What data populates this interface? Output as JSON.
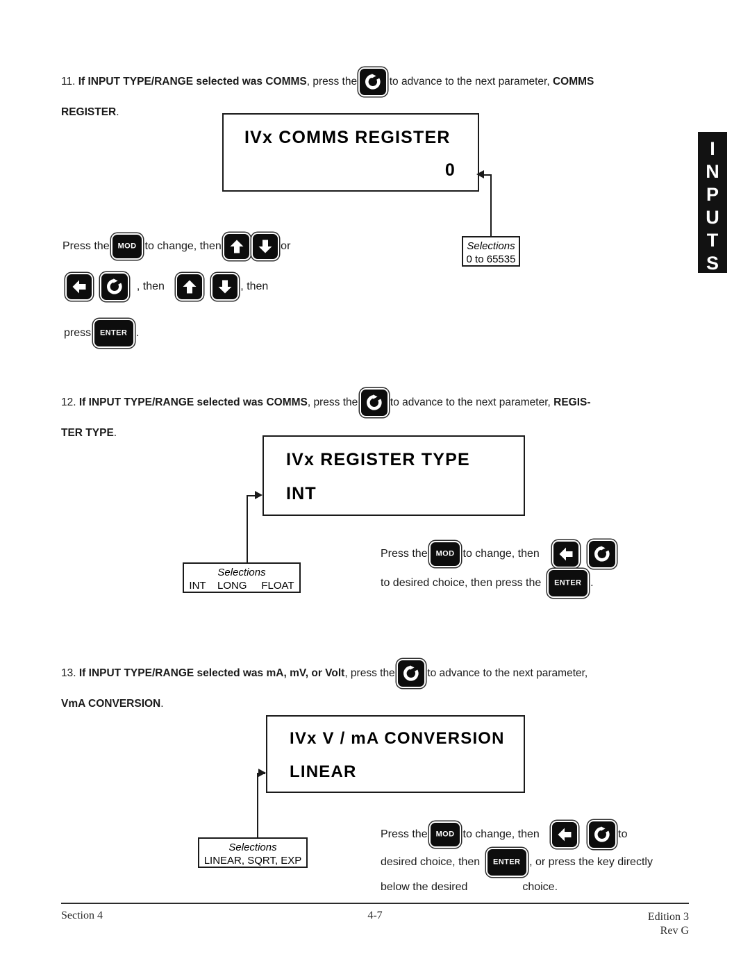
{
  "page": {
    "side_tab_label": "INPUTS",
    "side_tab_letters": [
      "I",
      "N",
      "P",
      "U",
      "T",
      "S"
    ]
  },
  "steps": [
    {
      "number": "11.",
      "text_before_key": "If INPUT TYPE/RANGE selected was COMMS",
      "lead_bold": "If INPUT TYPE/RANGE selected was COMMS",
      "after_bold": ", press the",
      "after_key": "to advance to the next parameter,",
      "param_bold": "COMMS",
      "continuation": "REGISTER",
      "continuation_period": ".",
      "key_icon": "advance-icon"
    },
    {
      "number": "12.",
      "lead_bold": "If INPUT TYPE/RANGE selected was COMMS",
      "after_bold": ", press the",
      "after_key": "to advance to the next parameter,",
      "param_bold": "REGIS-",
      "continuation": "TER TYPE",
      "continuation_period": ".",
      "key_icon": "advance-icon"
    },
    {
      "number": "13.",
      "lead_bold": "If INPUT TYPE/RANGE selected was mA, mV, or Volt",
      "after_bold": ", press the",
      "after_key": "to advance to the next parameter,",
      "param_bold": "",
      "continuation": "VmA CONVERSION",
      "continuation_period": ".",
      "key_icon": "advance-icon"
    }
  ],
  "displays": [
    {
      "line1": "IVx  COMMS  REGISTER",
      "line2": "0",
      "align2": "right"
    },
    {
      "line1": "IVx  REGISTER  TYPE",
      "line2": "INT",
      "align2": "left"
    },
    {
      "line1": "IVx  V / mA  CONVERSION",
      "line2": "LINEAR",
      "align2": "left"
    }
  ],
  "selections": [
    {
      "caption": "Selections",
      "values": "0 to 65535"
    },
    {
      "caption": "Selections",
      "values": "INT    LONG     FLOAT"
    },
    {
      "caption": "Selections",
      "values": "LINEAR, SQRT, EXP"
    }
  ],
  "instructions": {
    "block11": {
      "l1_a": "Press the",
      "l1_b": "to change, then",
      "l1_c": "or",
      "l2_a": ", then",
      "l2_b": ", then",
      "l3_a": "press",
      "l3_b": "."
    },
    "block12": {
      "l1_a": "Press  the",
      "l1_b": "to change, then",
      "l2_a": "to desired choice, then press the",
      "l2_b": "."
    },
    "block13": {
      "l1_a": "Press the",
      "l1_b": "to  change,  then",
      "l1_c": "to",
      "l2_a": "desired choice, then",
      "l2_b": ", or press the key directly",
      "l3_a": "below  the  desired",
      "l3_b": "choice."
    }
  },
  "keys": {
    "mod_label": "MOD",
    "enter_label": "ENTER",
    "up_icon": "arrow-up-icon",
    "down_icon": "arrow-down-icon",
    "left_icon": "arrow-left-icon",
    "advance_icon": "advance-icon"
  },
  "footer": {
    "left": "Section 4",
    "center": "4-7",
    "right_line1": "Edition 3",
    "right_line2": "Rev  G"
  },
  "colors": {
    "ink": "#1a1a1a",
    "key_fill": "#0d0d0d",
    "tab_fill": "#121212",
    "paper": "#ffffff"
  }
}
